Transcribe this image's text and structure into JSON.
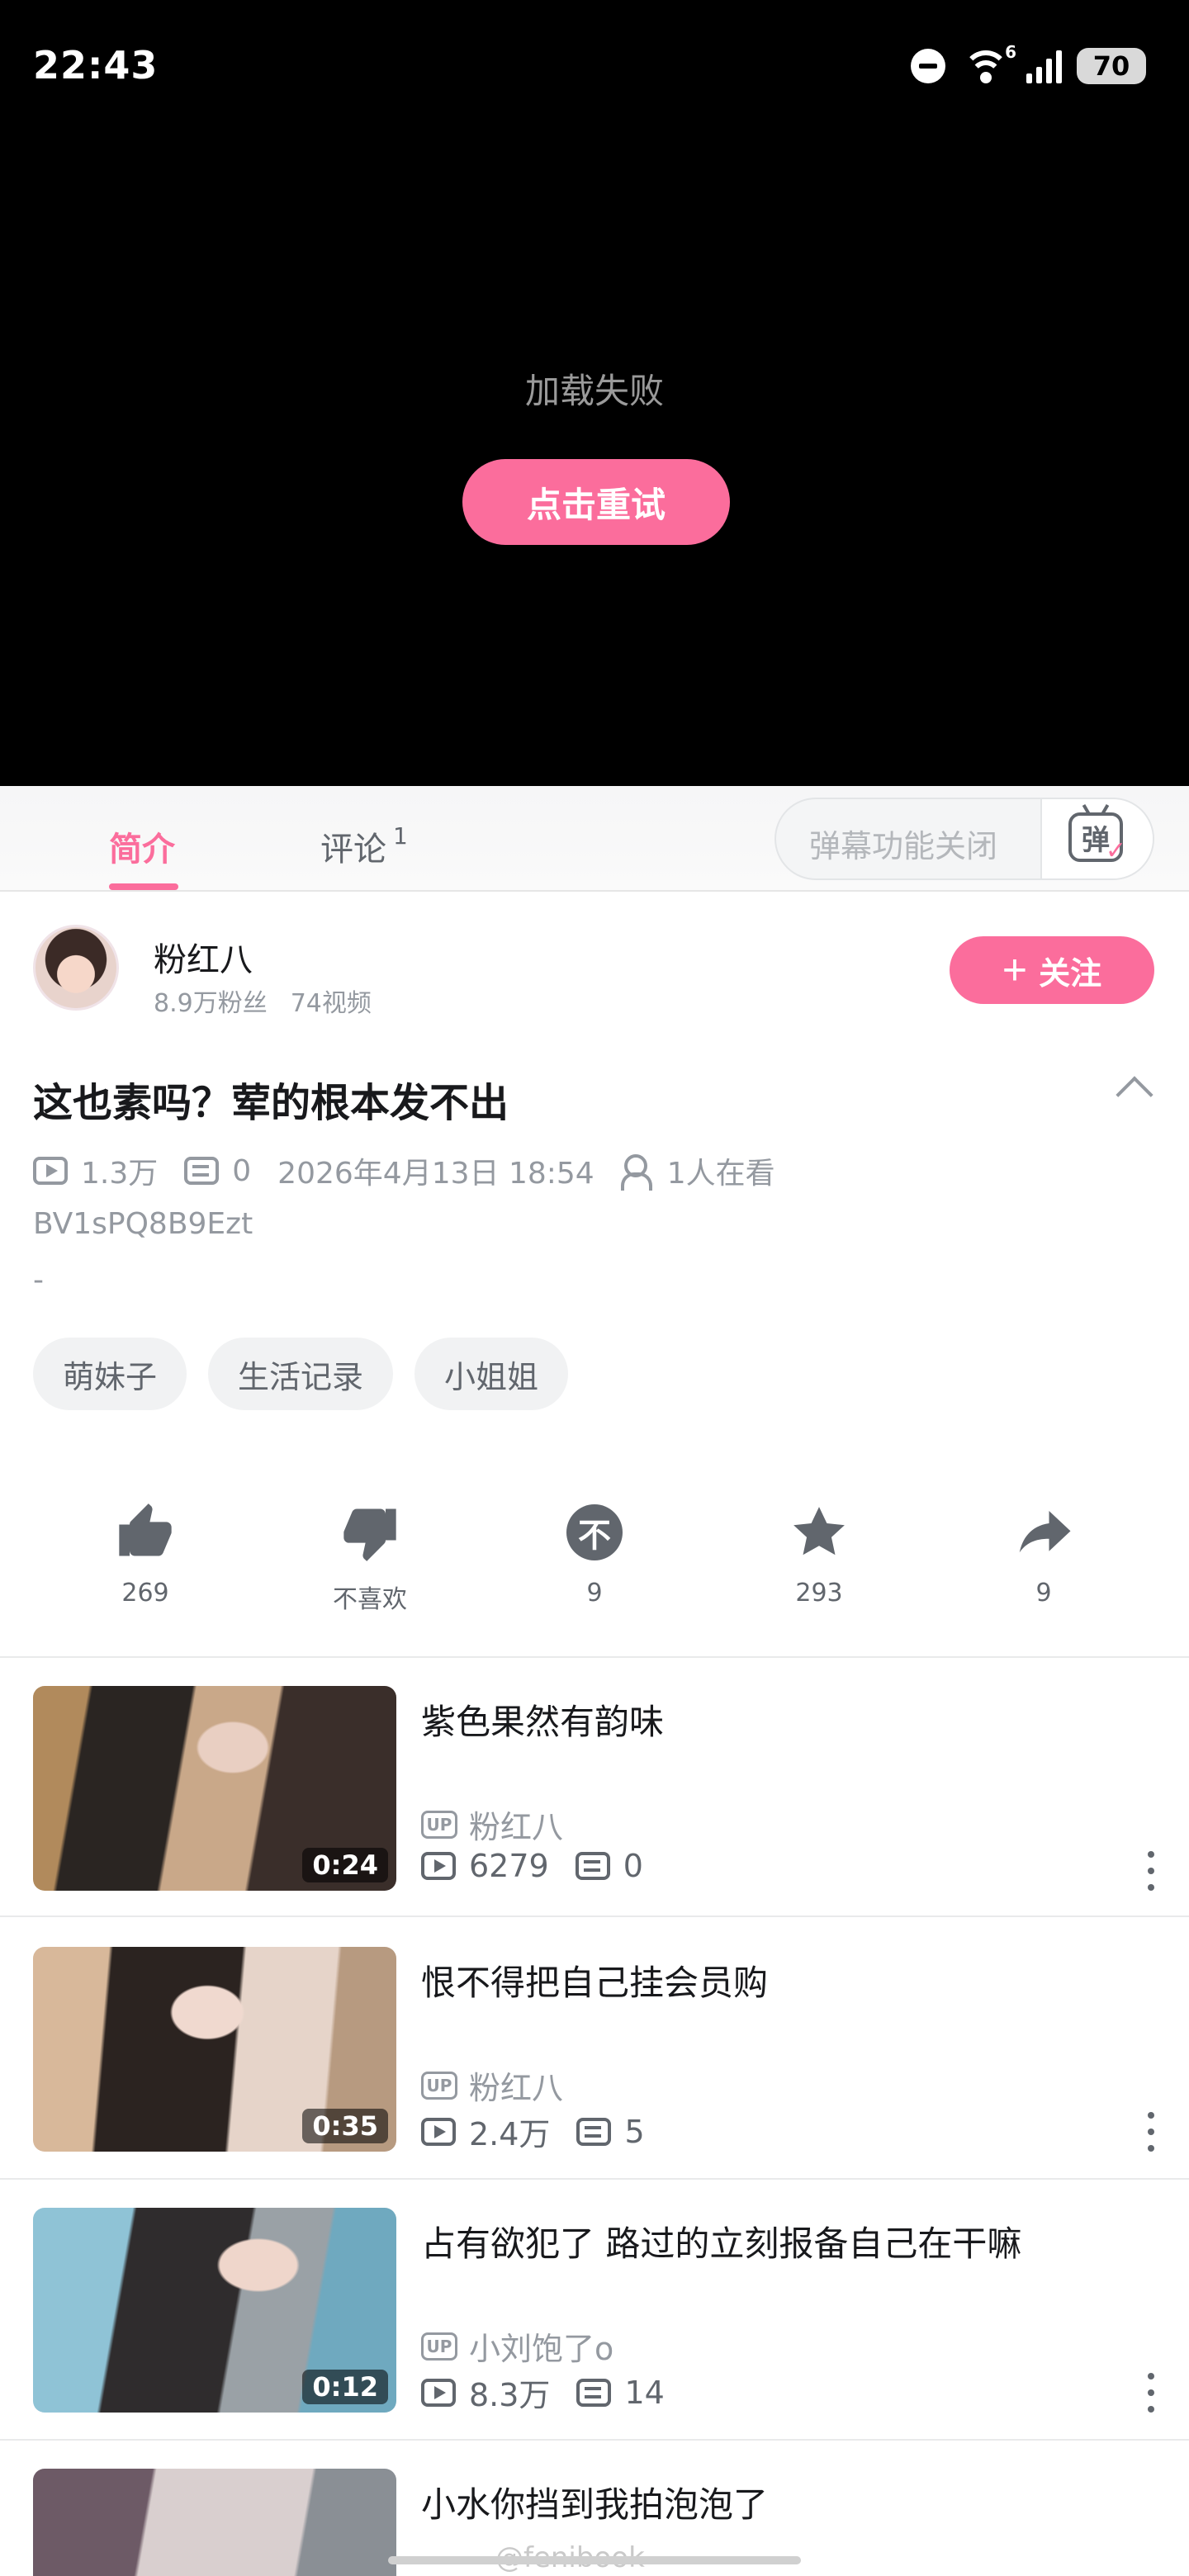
{
  "status_bar": {
    "time": "22:43",
    "battery": "70",
    "wifi_badge": "6"
  },
  "player": {
    "error_text": "加载失败",
    "retry_label": "点击重试"
  },
  "tabs": [
    {
      "label": "简介",
      "active": true
    },
    {
      "label": "评论",
      "count": "1",
      "active": false
    }
  ],
  "danmaku": {
    "input_placeholder": "弹幕功能关闭",
    "toggle_glyph": "弹"
  },
  "uploader": {
    "name": "粉红八",
    "fans": "8.9万粉丝",
    "videos": "74视频",
    "follow_label": "关注"
  },
  "video": {
    "title": "这也素吗？荤的根本发不出",
    "views": "1.3万",
    "danmaku_count": "0",
    "publish_time": "2026年4月13日 18:54",
    "watching": "1人在看",
    "bvid": "BV1sPQ8B9Ezt",
    "description": "-",
    "tags": [
      "萌妹子",
      "生活记录",
      "小姐姐"
    ]
  },
  "actions": {
    "like": "269",
    "dislike": "不喜欢",
    "coin": "9",
    "coin_glyph": "不",
    "favorite": "293",
    "share": "9"
  },
  "recommendations": [
    {
      "title": "紫色果然有韵味",
      "up": "粉红八",
      "views": "6279",
      "danmaku": "0",
      "duration": "0:24"
    },
    {
      "title": "恨不得把自己挂会员购",
      "up": "粉红八",
      "views": "2.4万",
      "danmaku": "5",
      "duration": "0:35"
    },
    {
      "title": "占有欲犯了 路过的立刻报备自己在干嘛",
      "up": "小刘饱了o",
      "views": "8.3万",
      "danmaku": "14",
      "duration": "0:12"
    },
    {
      "title": "小水你挡到我拍泡泡了",
      "up": "",
      "views": "",
      "danmaku": "",
      "duration": ""
    }
  ],
  "up_badge": "UP",
  "watermark": "@fenibook",
  "colors": {
    "accent": "#fb6d9c",
    "text_secondary": "#9499a0",
    "player_bg": "#000000"
  }
}
